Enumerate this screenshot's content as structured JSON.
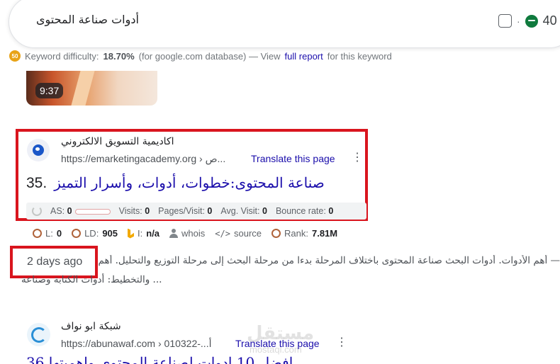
{
  "search": {
    "query": "أدوات صناعة المحتوى",
    "count": "40",
    "separator": "·"
  },
  "keyword_difficulty": {
    "badge": "50",
    "label": "Keyword difficulty:",
    "value": "18.70%",
    "database_note": "(for google.com database) — View",
    "report_link": "full report",
    "suffix": "for this keyword"
  },
  "video": {
    "duration": "9:37"
  },
  "result": {
    "site_name": "اكاديمية التسويق الالكتروني",
    "url": "https://emarketingacademy.org › ص...",
    "translate_label": "Translate this page",
    "menu_icon": "⋮",
    "rank_number": "35.",
    "title": "صناعة المحتوى:خطوات، أدوات، وأسرار التميز",
    "metrics": {
      "as_label": "AS:",
      "as_value": "0",
      "visits_label": "Visits:",
      "visits_value": "0",
      "pages_label": "Pages/Visit:",
      "pages_value": "0",
      "avg_label": "Avg. Visit:",
      "avg_value": "0",
      "bounce_label": "Bounce rate:",
      "bounce_value": "0"
    },
    "seo": {
      "l_label": "L:",
      "l_value": "0",
      "ld_label": "LD:",
      "ld_value": "905",
      "i_label": "I:",
      "i_value": "n/a",
      "whois_label": "whois",
      "source_label": "source",
      "rank_label": "Rank:",
      "rank_value": "7.81M"
    },
    "date": "2 days ago",
    "snippet_line1": "— أهم الأدوات. أدوات البحث صناعة المحتوى باختلاف المرحلة بدءا من مرحلة البحث إلى مرحلة التوزيع والتحليل. أهم الأدوات",
    "snippet_line2": "والتخطيط: أدوات الكتابة وصناعة ..."
  },
  "result2": {
    "site_name": "شبكة ابو نواف",
    "url": "https://abunawaf.com › أ...-010322",
    "translate_label": "Translate this page",
    "menu_icon": "⋮",
    "title_partial": "أفضل 10 أدوات لصناعة المحتوى وأهميتها 36."
  },
  "watermark": {
    "text": "مستقل",
    "subtext": "mostaql.com"
  },
  "colors": {
    "link": "#1a0dab",
    "highlight_box": "#d9151e",
    "text_secondary": "#4d5156"
  }
}
